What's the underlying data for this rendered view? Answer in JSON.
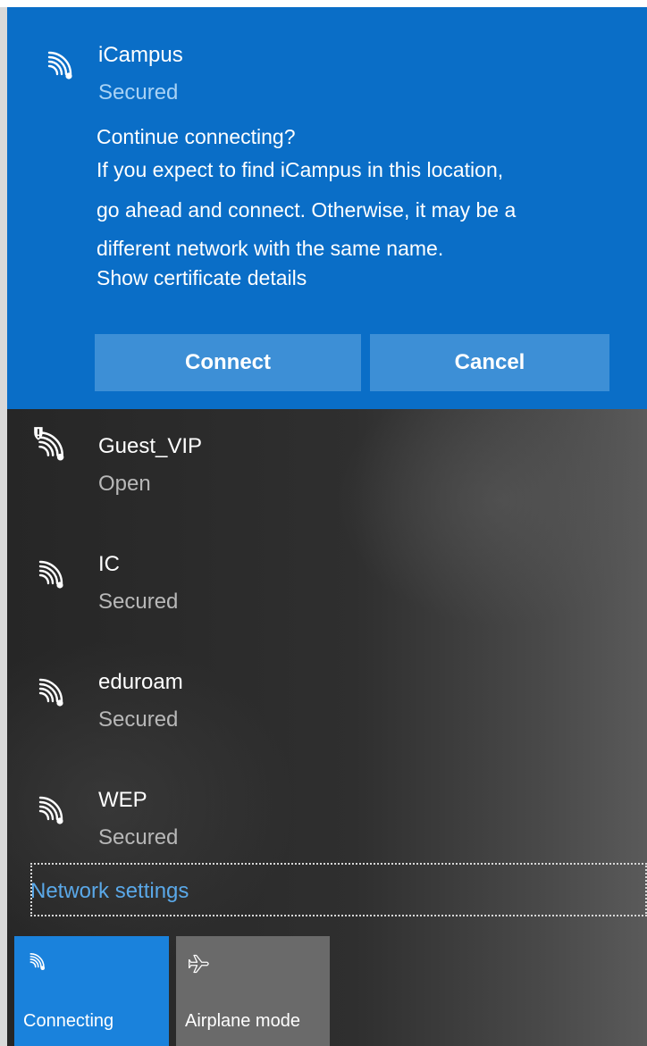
{
  "active_network": {
    "name": "iCampus",
    "status": "Secured",
    "icon": "wifi-signal-icon",
    "prompt_lines": [
      "Continue connecting?",
      "If you expect to find iCampus in this location,",
      "go ahead and connect. Otherwise, it may be a",
      "different network with the same name.",
      "Show certificate details"
    ],
    "connect_label": "Connect",
    "cancel_label": "Cancel"
  },
  "networks": [
    {
      "name": "Guest_VIP",
      "status": "Open",
      "icon": "wifi-open-warning-icon"
    },
    {
      "name": "IC",
      "status": "Secured",
      "icon": "wifi-signal-icon"
    },
    {
      "name": "eduroam",
      "status": "Secured",
      "icon": "wifi-signal-icon"
    },
    {
      "name": "WEP",
      "status": "Secured",
      "icon": "wifi-signal-icon"
    }
  ],
  "network_settings_label": "Network settings",
  "quick_actions": [
    {
      "label": "Connecting",
      "icon": "wifi-icon",
      "active": true
    },
    {
      "label": "Airplane mode",
      "icon": "airplane-icon",
      "active": false
    }
  ],
  "colors": {
    "accent": "#0a6ec7",
    "button": "#3d8fd6",
    "link": "#5aa8e8",
    "tile_active": "#1a82dc",
    "tile_inactive": "#6a6a6a"
  }
}
